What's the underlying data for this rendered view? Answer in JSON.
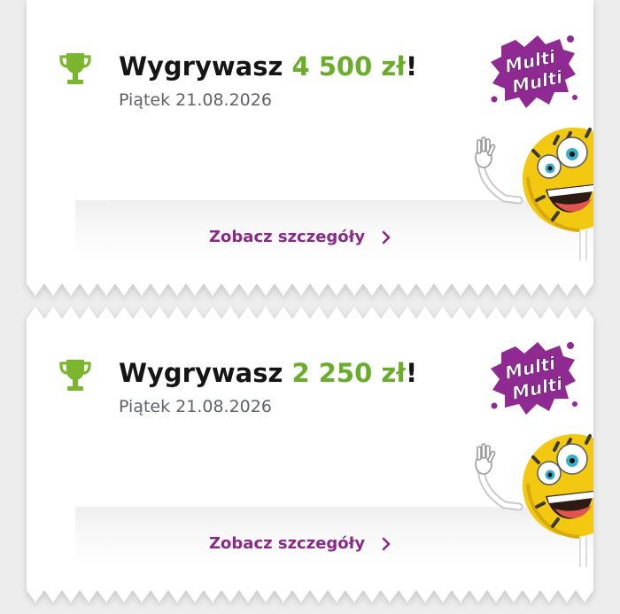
{
  "cards": [
    {
      "title_prefix": "Wygrywasz ",
      "amount": "4 500 zł",
      "title_suffix": "!",
      "date": "Piątek 21.08.2026",
      "details_label": "Zobacz szczegóły",
      "logo": {
        "line1": "Multi",
        "line2": "Multi"
      }
    },
    {
      "title_prefix": "Wygrywasz ",
      "amount": "2 250 zł",
      "title_suffix": "!",
      "date": "Piątek 21.08.2026",
      "details_label": "Zobacz szczegóły",
      "logo": {
        "line1": "Multi",
        "line2": "Multi"
      }
    }
  ],
  "icons": {
    "trophy": "trophy-icon",
    "chevron": "chevron-right-icon",
    "mascot": "mascot-ball-illustration"
  },
  "colors": {
    "amount": "#6aad2b",
    "trophy": "#7ab62e",
    "link": "#8a2a86",
    "brand_purple": "#8e2a91",
    "mascot_yellow": "#f2c811",
    "background": "#ededed",
    "card": "#ffffff"
  }
}
